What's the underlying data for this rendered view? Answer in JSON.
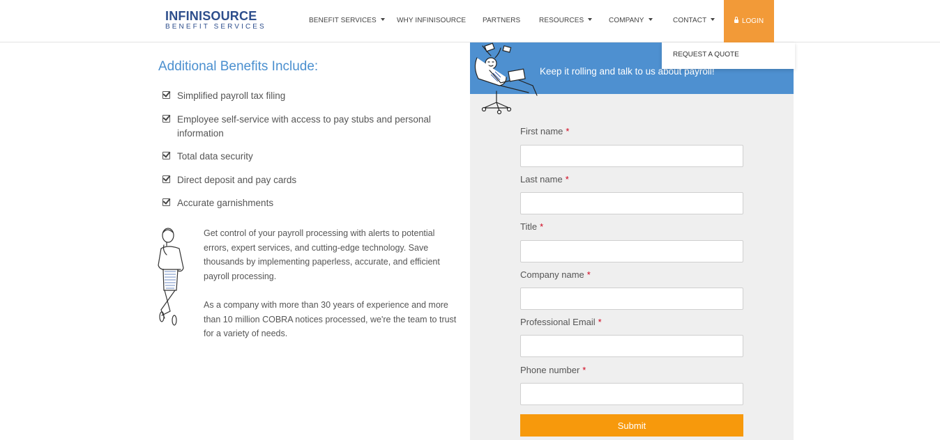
{
  "logo": {
    "top": "INFINISOURCE",
    "bottom": "BENEFIT SERVICES"
  },
  "nav": {
    "items": [
      {
        "label": "BENEFIT SERVICES",
        "has_caret": true
      },
      {
        "label": "WHY INFINISOURCE",
        "has_caret": false
      },
      {
        "label": "PARTNERS",
        "has_caret": false
      },
      {
        "label": "RESOURCES",
        "has_caret": true
      },
      {
        "label": "COMPANY",
        "has_caret": true
      },
      {
        "label": "CONTACT",
        "has_caret": true
      }
    ],
    "login_label": "LOGIN",
    "dropdown_item": "REQUEST A QUOTE"
  },
  "main": {
    "title": "Additional Benefits Include:",
    "benefits": [
      "Simplified payroll tax filing",
      "Employee self-service with access to pay stubs and personal information",
      "Total data security",
      "Direct deposit and pay cards",
      "Accurate garnishments"
    ],
    "paragraph1": "Get control of your payroll processing with alerts to potential errors, expert services, and cutting-edge technology. Save thousands by implementing paperless, accurate, and efficient payroll processing.",
    "paragraph2": "As a company with more than 30 years of experience and more than 10 million COBRA notices processed, we're the team to trust for a variety of needs."
  },
  "form": {
    "banner_text": "Keep it rolling and talk to us about payroll!",
    "required_marker": "*",
    "fields": [
      {
        "label": "First name",
        "value": ""
      },
      {
        "label": "Last name",
        "value": ""
      },
      {
        "label": "Title",
        "value": ""
      },
      {
        "label": "Company name",
        "value": ""
      },
      {
        "label": "Professional Email",
        "value": ""
      },
      {
        "label": "Phone number",
        "value": ""
      }
    ],
    "submit_label": "Submit"
  },
  "colors": {
    "brand_blue": "#2d4e8c",
    "accent_blue": "#4a8fcf",
    "banner_blue": "#4e90d0",
    "login_orange": "#f29a38",
    "submit_orange": "#f7990c",
    "required_red": "#d0021b"
  }
}
